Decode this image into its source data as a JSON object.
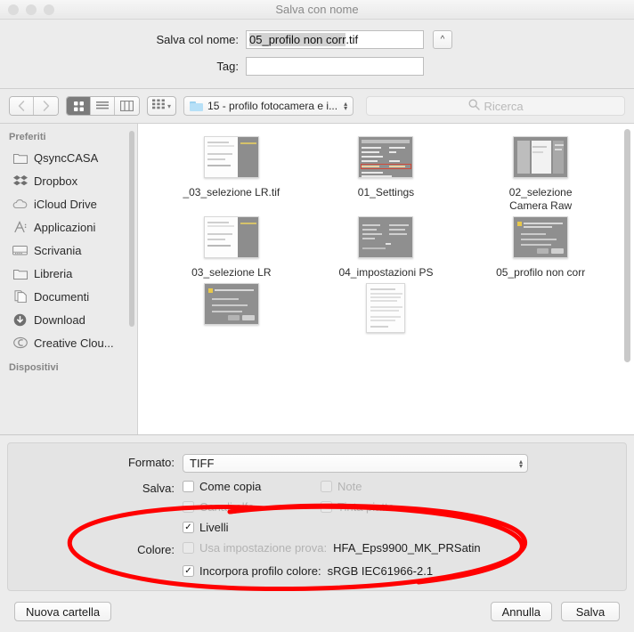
{
  "window": {
    "title": "Salva con nome",
    "traffic_lights": [
      "close",
      "minimize",
      "zoom"
    ]
  },
  "name_fields": {
    "filename_label": "Salva col nome:",
    "filename_selected": "05_profilo non corr",
    "filename_extension": ".tif",
    "tag_label": "Tag:",
    "tag_value": "",
    "disclosure_icon": "chevron-up-icon"
  },
  "toolbar": {
    "back_icon": "chevron-left-icon",
    "forward_icon": "chevron-right-icon",
    "view_icon_grid": "icon-view-icon",
    "view_list": "list-view-icon",
    "view_column": "column-view-icon",
    "arrange_icon": "arrange-by-icon",
    "arrange_chevron": "chevron-down-icon",
    "path_folder_icon": "folder-icon",
    "path_value": "15 - profilo fotocamera e i...",
    "path_stepper_icon": "up-down-chevron-icon",
    "search_icon": "search-icon",
    "search_placeholder": "Ricerca"
  },
  "sidebar": {
    "sections": [
      {
        "header": "Preferiti",
        "items": [
          {
            "label": "QsyncCASA",
            "icon": "folder-icon"
          },
          {
            "label": "Dropbox",
            "icon": "dropbox-icon"
          },
          {
            "label": "iCloud Drive",
            "icon": "cloud-icon"
          },
          {
            "label": "Applicazioni",
            "icon": "applications-icon"
          },
          {
            "label": "Scrivania",
            "icon": "desktop-icon"
          },
          {
            "label": "Libreria",
            "icon": "folder-icon"
          },
          {
            "label": "Documenti",
            "icon": "documents-icon"
          },
          {
            "label": "Download",
            "icon": "download-icon"
          },
          {
            "label": "Creative Clou...",
            "icon": "creative-cloud-icon"
          }
        ]
      },
      {
        "header": "Dispositivi",
        "items": []
      }
    ]
  },
  "files": [
    {
      "label": "_03_selezione LR.tif",
      "thumb": "screenshot-light"
    },
    {
      "label": "01_Settings",
      "thumb": "settings-dark"
    },
    {
      "label": "02_selezione\nCamera Raw",
      "thumb": "camera-raw"
    },
    {
      "label": "03_selezione LR",
      "thumb": "screenshot-light"
    },
    {
      "label": "04_impostazioni PS",
      "thumb": "dialog-dark"
    },
    {
      "label": "05_profilo non corr",
      "thumb": "dialog-warning"
    },
    {
      "label": "",
      "thumb": "dialog-warning"
    },
    {
      "label": "",
      "thumb": "text-document"
    }
  ],
  "options": {
    "format_label": "Formato:",
    "format_value": "TIFF",
    "format_stepper_icon": "up-down-chevron-icon",
    "save_label": "Salva:",
    "checkboxes": [
      {
        "label": "Come copia",
        "checked": false,
        "enabled": true
      },
      {
        "label": "Note",
        "checked": false,
        "enabled": false
      },
      {
        "label": "Canali alfa",
        "checked": false,
        "enabled": false
      },
      {
        "label": "Tinta piatta",
        "checked": false,
        "enabled": false
      },
      {
        "label": "Livelli",
        "checked": true,
        "enabled": true
      }
    ],
    "color_label": "Colore:",
    "proof_label": "Usa impostazione prova:",
    "proof_value": "HFA_Eps9900_MK_PRSatin",
    "proof_checked": false,
    "proof_enabled": false,
    "embed_label": "Incorpora profilo colore:",
    "embed_value": "sRGB IEC61966-2.1",
    "embed_checked": true,
    "embed_enabled": true,
    "checkmark_glyph": "✓"
  },
  "footer": {
    "new_folder": "Nuova cartella",
    "cancel": "Annulla",
    "save": "Salva"
  },
  "annotation": {
    "shape": "hand-drawn-ellipse",
    "color": "#FF0000",
    "stroke_width": 5
  }
}
